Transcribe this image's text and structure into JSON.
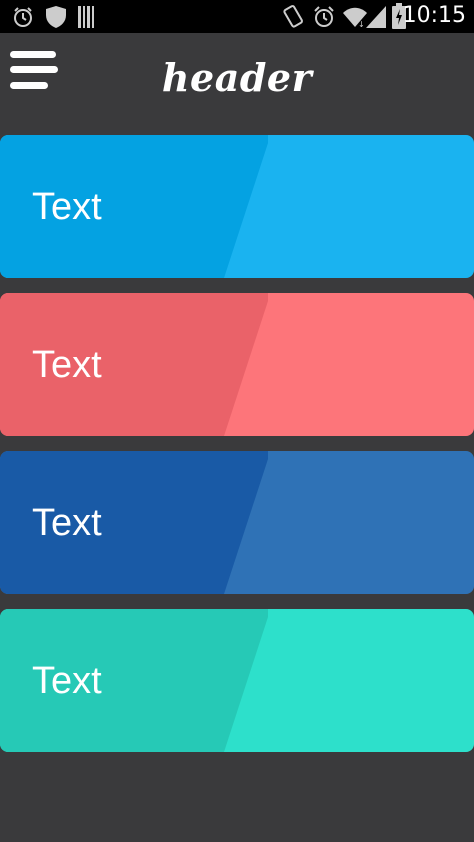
{
  "status_bar": {
    "time": "10:15",
    "icons": [
      "alarm-icon",
      "shield-icon",
      "barcode-icon",
      "vibrate-icon",
      "alarm-clock-icon",
      "wifi-icon",
      "signal-icon",
      "battery-charging-icon"
    ]
  },
  "app_bar": {
    "title": "header",
    "menu_icon": "hamburger-menu-icon"
  },
  "cards": [
    {
      "label": "Text",
      "color": "#1ab3f0",
      "panel_color": "#04a2e2"
    },
    {
      "label": "Text",
      "color": "#fd757a",
      "panel_color": "#ea6269"
    },
    {
      "label": "Text",
      "color": "#2f72b6",
      "panel_color": "#195aa6"
    },
    {
      "label": "Text",
      "color": "#2de0cb",
      "panel_color": "#26c9b6"
    }
  ],
  "colors": {
    "background": "#3a3a3c",
    "status_bar": "#000000"
  }
}
